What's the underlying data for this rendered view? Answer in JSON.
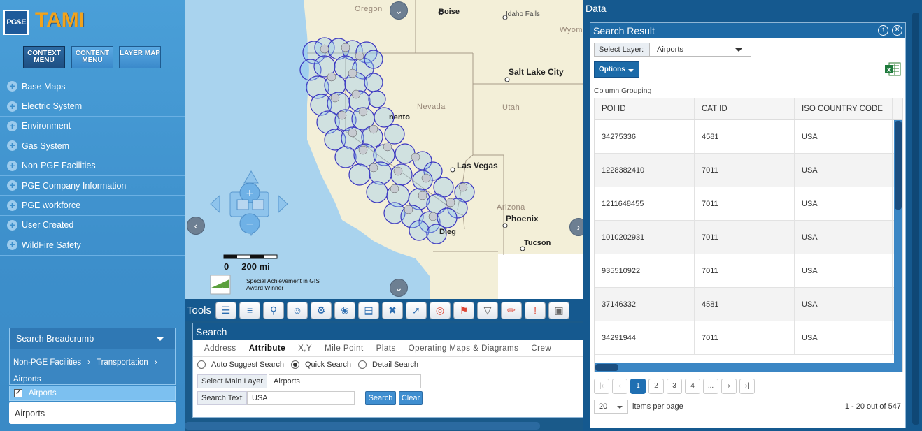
{
  "app": {
    "logo_text": "PG&E",
    "title": "TAMI"
  },
  "menu_buttons": [
    {
      "label": "CONTEXT MENU",
      "active": true
    },
    {
      "label": "CONTENT MENU",
      "active": false
    },
    {
      "label": "LAYER MAP",
      "active": false
    }
  ],
  "nav": {
    "items": [
      {
        "label": "Base Maps"
      },
      {
        "label": "Electric System"
      },
      {
        "label": "Environment"
      },
      {
        "label": "Gas System"
      },
      {
        "label": "Non-PGE Facilities"
      },
      {
        "label": "PGE Company Information"
      },
      {
        "label": "PGE workforce"
      },
      {
        "label": "User Created"
      },
      {
        "label": "WildFire Safety"
      }
    ]
  },
  "breadcrumb": {
    "header": "Search Breadcrumb",
    "path": [
      "Non-PGE Facilities",
      "Transportation",
      "Airports"
    ],
    "selected_layer": "Airports",
    "selected_checked": true,
    "active_item": "Airports"
  },
  "map": {
    "states": [
      "Oregon",
      "Nevada",
      "Utah",
      "Arizona",
      "Wyomi"
    ],
    "cities": [
      "Boise",
      "Idaho Falls",
      "Salt Lake City",
      "Las Vegas",
      "Phoenix",
      "Tucson",
      "nento",
      "Dieg"
    ],
    "scale": {
      "zero": "0",
      "distance": "200 mi"
    },
    "esri": {
      "logo": "esri",
      "line1": "Special  Achievement in GIS",
      "line2": "Award Winner"
    }
  },
  "tools": {
    "label": "Tools",
    "icons": [
      "layers-icon",
      "list-icon",
      "find-icon",
      "user-icon",
      "network-icon",
      "puzzle-icon",
      "database-icon",
      "cross-icon",
      "measure-icon",
      "spiral-icon",
      "flag-icon",
      "filter-icon",
      "ruler-icon",
      "alert-icon",
      "gauge-icon"
    ]
  },
  "search": {
    "title": "Search",
    "tabs": [
      {
        "label": "Address",
        "active": false
      },
      {
        "label": "Attribute",
        "active": true
      },
      {
        "label": "X,Y",
        "active": false
      },
      {
        "label": "Mile Point",
        "active": false
      },
      {
        "label": "Plats",
        "active": false
      },
      {
        "label": "Operating Maps & Diagrams",
        "active": false
      },
      {
        "label": "Crew",
        "active": false
      }
    ],
    "modes": [
      {
        "label": "Auto Suggest Search",
        "selected": false
      },
      {
        "label": "Quick Search",
        "selected": true
      },
      {
        "label": "Detail Search",
        "selected": false
      }
    ],
    "main_layer_label": "Select Main Layer:",
    "main_layer_value": "Airports",
    "text_label": "Search Text:",
    "text_value": "USA",
    "search_btn": "Search",
    "clear_btn": "Clear"
  },
  "data": {
    "title": "Data",
    "result_title": "Search Result",
    "layer_label": "Select Layer:",
    "layer_value": "Airports",
    "options_label": "Options",
    "column_grouping": "Column Grouping",
    "columns": [
      "POI ID",
      "CAT ID",
      "ISO COUNTRY CODE"
    ],
    "rows": [
      [
        "34275336",
        "4581",
        "USA"
      ],
      [
        "1228382410",
        "7011",
        "USA"
      ],
      [
        "1211648455",
        "7011",
        "USA"
      ],
      [
        "1010202931",
        "7011",
        "USA"
      ],
      [
        "935510922",
        "7011",
        "USA"
      ],
      [
        "37146332",
        "4581",
        "USA"
      ],
      [
        "34291944",
        "7011",
        "USA"
      ]
    ],
    "pages": [
      "1",
      "2",
      "3",
      "4",
      "..."
    ],
    "current_page": "1",
    "per_page": "20",
    "per_page_label": "items per page",
    "count": "1 - 20 out of 547"
  }
}
